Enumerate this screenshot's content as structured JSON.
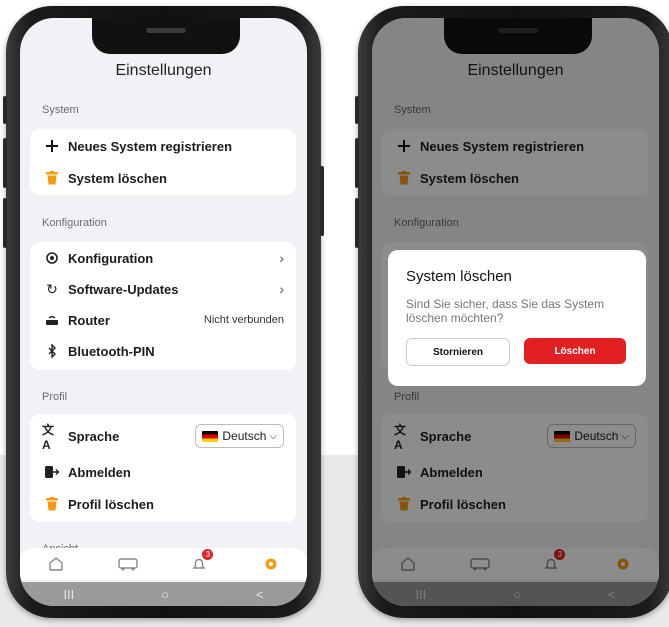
{
  "left_screen": {
    "title": "Einstellungen",
    "sections": {
      "system": "System",
      "configuration": "Konfiguration",
      "profile": "Profil",
      "footer_partial": "Ansicht"
    },
    "system_items": [
      {
        "label": "Neues System registrieren",
        "icon": "plus-icon"
      },
      {
        "label": "System löschen",
        "icon": "trash-icon"
      }
    ],
    "config_items": [
      {
        "label": "Konfiguration",
        "icon": "settings-icon"
      },
      {
        "label": "Software-Updates",
        "icon": "refresh-icon"
      },
      {
        "label": "Router",
        "icon": "router-icon",
        "value": "Nicht verbunden"
      },
      {
        "label": "Bluetooth-PIN",
        "icon": "bluetooth-icon"
      }
    ],
    "profile_items": [
      {
        "label": "Sprache",
        "icon": "translate-icon"
      },
      {
        "label": "Abmelden",
        "icon": "logout-icon"
      },
      {
        "label": "Profil löschen",
        "icon": "trash-icon"
      }
    ],
    "language": {
      "selected": "Deutsch"
    },
    "tabbar": {
      "badge_count": "3"
    },
    "navbar": {
      "recents": "III",
      "home": "○",
      "back": "<"
    }
  },
  "right_screen": {
    "title": "Einstellungen",
    "sections": {
      "system": "System",
      "configuration": "Konfiguration",
      "profile": "Profil"
    },
    "system_items": [
      "Neues System registrieren",
      "System löschen"
    ],
    "profile_items": [
      "Sprache",
      "Abmelden",
      "Profil löschen"
    ],
    "language": {
      "selected": "Deutsch"
    },
    "tabbar": {
      "badge_count": "3"
    },
    "dialog": {
      "title": "System löschen",
      "message": "Sind Sie sicher, dass Sie das System löschen möchten?",
      "cancel_label": "Stornieren",
      "confirm_label": "Löschen"
    }
  },
  "colors": {
    "accent": "#f39c12",
    "danger": "#e32021",
    "badge": "#e02424"
  }
}
